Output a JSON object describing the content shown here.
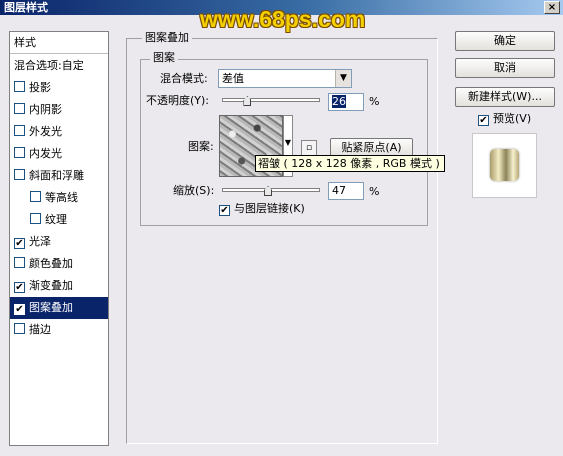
{
  "window": {
    "title": "图层样式",
    "close_glyph": "×"
  },
  "watermark": "www.68ps.com",
  "style_list": {
    "header": "样式",
    "blend_options": "混合选项:自定",
    "items": [
      {
        "label": "投影",
        "checked": false,
        "selected": false,
        "indent": false
      },
      {
        "label": "内阴影",
        "checked": false,
        "selected": false,
        "indent": false
      },
      {
        "label": "外发光",
        "checked": false,
        "selected": false,
        "indent": false
      },
      {
        "label": "内发光",
        "checked": false,
        "selected": false,
        "indent": false
      },
      {
        "label": "斜面和浮雕",
        "checked": false,
        "selected": false,
        "indent": false
      },
      {
        "label": "等高线",
        "checked": false,
        "selected": false,
        "indent": true
      },
      {
        "label": "纹理",
        "checked": false,
        "selected": false,
        "indent": true
      },
      {
        "label": "光泽",
        "checked": true,
        "selected": false,
        "indent": false
      },
      {
        "label": "颜色叠加",
        "checked": false,
        "selected": false,
        "indent": false
      },
      {
        "label": "渐变叠加",
        "checked": true,
        "selected": false,
        "indent": false
      },
      {
        "label": "图案叠加",
        "checked": true,
        "selected": true,
        "indent": false
      },
      {
        "label": "描边",
        "checked": false,
        "selected": false,
        "indent": false
      }
    ]
  },
  "panel": {
    "group_title": "图案叠加",
    "inner_title": "图案",
    "blend_mode_label": "混合模式:",
    "blend_mode_value": "差值",
    "opacity_label": "不透明度(Y):",
    "opacity_value": "26",
    "opacity_unit": "%",
    "opacity_level": 0.26,
    "pattern_label": "图案:",
    "snap_button": "贴紧原点(A)",
    "tooltip": "褶皱 ( 128 x 128 像素 , RGB 模式 )",
    "scale_label": "缩放(S):",
    "scale_value": "47",
    "scale_unit": "%",
    "scale_level": 0.47,
    "link_label": "与图层链接(K)",
    "link_checked": true,
    "check_glyph": "✔"
  },
  "buttons": {
    "ok": "确定",
    "cancel": "取消",
    "new_style": "新建样式(W)...",
    "preview_label": "预览(V)",
    "preview_checked": true
  }
}
